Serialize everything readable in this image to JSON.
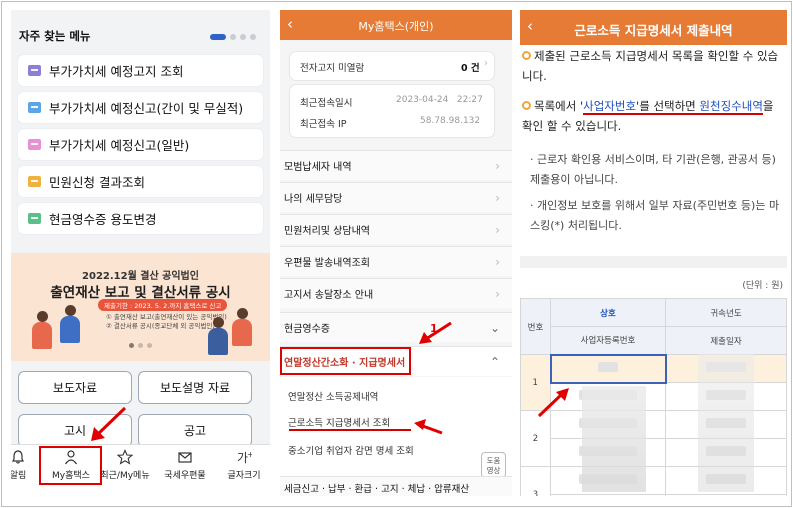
{
  "panel1": {
    "frequent_menu_title": "자주 찾는 메뉴",
    "menu_items": [
      {
        "label": "부가가치세 예정고지 조회",
        "color": "#8b7fd6"
      },
      {
        "label": "부가가치세 예정신고(간이 및 무실적)",
        "color": "#5ba4e6"
      },
      {
        "label": "부가가치세 예정신고(일반)",
        "color": "#e690d6"
      },
      {
        "label": "민원신청 결과조회",
        "color": "#f0b23e"
      },
      {
        "label": "현금영수증 용도변경",
        "color": "#5cbf8a"
      }
    ],
    "banner": {
      "line1": "2022.12월 결산 공익법인",
      "line2": "출연재산 보고 및 결산서류 공시",
      "deadline": "제출기한 : 2023. 5. 2.까지 홈택스로 신고",
      "item1": "① 출연재산 보고(출연재산이 있는 공익법인)",
      "item2": "② 결산서류 공시(종교단체 외 공익법인)"
    },
    "buttons": [
      "보도자료",
      "보도설명 자료",
      "고시",
      "공고"
    ],
    "tabbar": [
      "알림",
      "My홈택스",
      "최근/My메뉴",
      "국세우편물",
      "글자크기"
    ]
  },
  "panel2": {
    "title": "My홈택스(개인)",
    "unread_label": "전자고지 미열람",
    "unread_value": "0 건",
    "last_login_label": "최근접속일시",
    "last_login_value": "2023-04-24   22:27",
    "last_ip_label": "최근접속 IP",
    "last_ip_value": "58.78.98.132",
    "menu": [
      "모범납세자 내역",
      "나의 세무담당",
      "민원처리및 상담내역",
      "우편물 발송내역조회",
      "고지서 송달장소 안내",
      "현금영수증",
      "연말정산간소화 · 지급명세서"
    ],
    "submenu": [
      "연말정산 소득공제내역",
      "근로소득 지급명세서 조회",
      "중소기업 취업자 감면 명세 조회"
    ],
    "last_row": "세금신고 · 납부 · 환급 · 고지 · 체납 · 압류재산",
    "step_label": "1",
    "help_line1": "도움",
    "help_line2": "영상"
  },
  "panel3": {
    "title": "근로소득 지급명세서 제출내역",
    "bullet1": "제출된 근로소득 지급명세서 목록을 확인할 수 있습니다.",
    "bullet2_pre": "목록에서 '",
    "bullet2_link1": "사업자번호",
    "bullet2_mid": "'를 선택하면 ",
    "bullet2_link2": "원천징수내역",
    "bullet2_post": "을 확인 할 수 있습니다.",
    "note1": "· 근로자 확인용 서비스이며, 타 기관(은행, 관공서 등) 제출용이 아닙니다.",
    "note2": "· 개인정보 보호를 위해서 일부 자료(주민번호 등)는 마스킹(*) 처리됩니다.",
    "unit": "(단위 : 원)",
    "table": {
      "col_no": "번호",
      "col_name": "상호",
      "col_regno": "사업자등록번호",
      "col_year": "귀속년도",
      "col_date": "제출일자",
      "rows": [
        "1",
        "2",
        "3"
      ]
    }
  }
}
